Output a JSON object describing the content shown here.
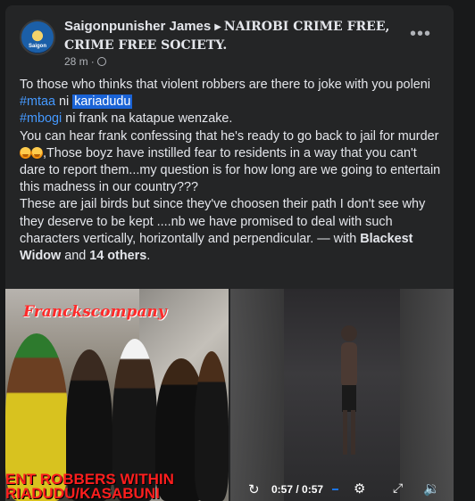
{
  "post": {
    "author": "Saigonpunisher James",
    "group": "NAIROBI CRIME FREE, CRIME FREE SOCIETY.",
    "time": "28 m",
    "meta_sep": "·",
    "more_label": "•••",
    "avatar_text": "Saigon"
  },
  "body": {
    "line1": "To those who thinks that violent robbers are there to joke with you poleni",
    "tag_mtaa": "#mtaa",
    "word_ni": " ni ",
    "highlight": "kariadudu",
    "tag_mbogi": "#mbogi",
    "line3_rest": " ni frank na katapue wenzake.",
    "para2_a": "You can hear frank confessing that he's ready to go back to jail for murder",
    "para2_b": ",Those boyz have instilled fear to residents in a way that you can't dare to report them...my question is for how long are we going to entertain this madness in our country???",
    "para3_a": "These are jail birds but since they've choosen their path I don't see why they deserve to be kept ....nb we have promised  to deal with such characters vertically, horizontally and perpendicular. — with ",
    "with_1": "Blackest Widow",
    "and": " and ",
    "with_2": "14 others",
    "period": "."
  },
  "media": {
    "photo_title": "Franckscompany",
    "photo_caption_1": "ENT ROBBERS WITHIN",
    "photo_caption_2": "RIADUDU/KASABUNI",
    "video_time": "0:57 / 0:57",
    "icons": [
      "replay-icon",
      "settings-icon",
      "fullscreen-icon",
      "volume-icon"
    ]
  }
}
